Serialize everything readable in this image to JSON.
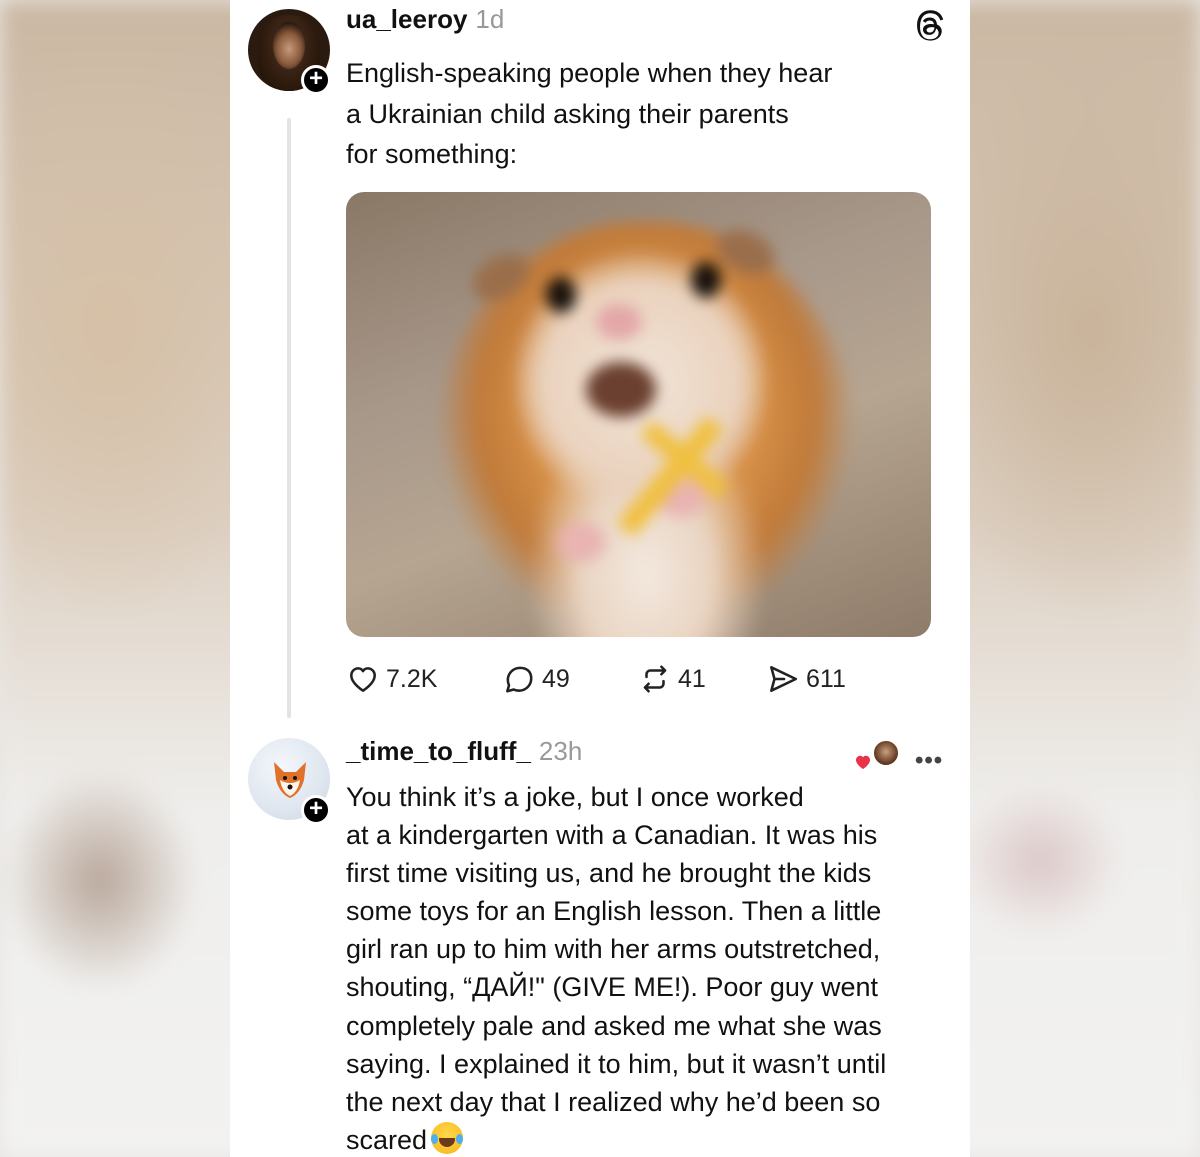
{
  "post": {
    "username": "ua_leeroy",
    "time": "1d",
    "text": "English-speaking people when they hear\na Ukrainian child asking their parents\nfor something:",
    "stats": {
      "likes": "7.2K",
      "comments": "49",
      "reposts": "41",
      "shares": "611"
    }
  },
  "reply": {
    "username": "_time_to_fluff_",
    "time": "23h",
    "text": "You think it’s a joke, but I once worked\nat a kindergarten with a Canadian. It was his\nfirst time visiting us, and he brought the kids\nsome toys for an English lesson. Then a little\ngirl ran up to him with her arms outstretched,\nshouting, “ДАЙ!\" (GIVE ME!). Poor guy went\ncompletely pale and asked me what she was\nsaying. I explained it to him, but it wasn’t until\nthe next day that I realized why he’d been so\nscared",
    "more": "•••"
  },
  "icons": {
    "app_logo": "threads-logo-icon",
    "like": "heart-icon",
    "comment": "comment-bubble-icon",
    "repost": "repost-icon",
    "share": "send-icon",
    "follow": "plus-icon",
    "liked_by_author": "heart-badge-icon",
    "emoji": "laughing-tears-emoji"
  },
  "colors": {
    "card_bg": "#ffffff",
    "text": "#111111",
    "muted": "#999999",
    "heart_badge": "#e8334a"
  }
}
